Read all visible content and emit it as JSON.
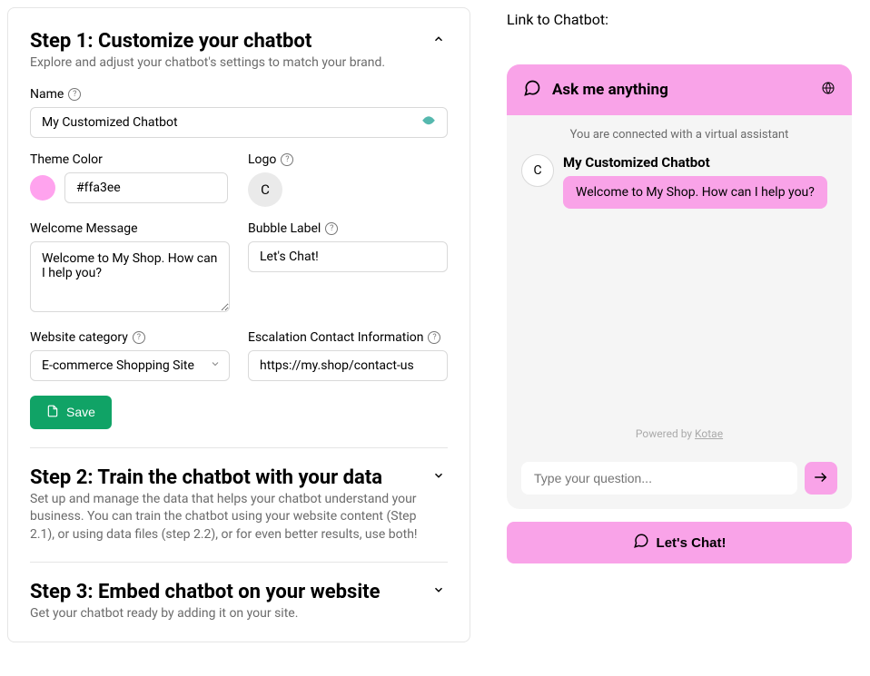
{
  "step1": {
    "title": "Step 1: Customize your chatbot",
    "desc": "Explore and adjust your chatbot's settings to match your brand.",
    "name_label": "Name",
    "name_value": "My Customized Chatbot",
    "theme_color_label": "Theme Color",
    "theme_color_value": "#ffa3ee",
    "logo_label": "Logo",
    "logo_letter": "C",
    "welcome_label": "Welcome Message",
    "welcome_value": "Welcome to My Shop. How can I help you?",
    "bubble_label_label": "Bubble Label",
    "bubble_label_value": "Let's Chat!",
    "category_label": "Website category",
    "category_value": "E-commerce Shopping Site",
    "escalation_label": "Escalation Contact Information",
    "escalation_value": "https://my.shop/contact-us",
    "save_label": "Save"
  },
  "step2": {
    "title": "Step 2: Train the chatbot with your data",
    "desc": "Set up and manage the data that helps your chatbot understand your business. You can train the chatbot using your website content (Step 2.1), or using data files (step 2.2), or for even better results, use both!"
  },
  "step3": {
    "title": "Step 3: Embed chatbot on your website",
    "desc": "Get your chatbot ready by adding it on your site."
  },
  "right": {
    "link_label": "Link to Chatbot:"
  },
  "chat": {
    "header_title": "Ask me anything",
    "connected_text": "You are connected with a virtual assistant",
    "bot_name": "My Customized Chatbot",
    "avatar_letter": "C",
    "welcome_msg": "Welcome to My Shop. How can I help you?",
    "powered_prefix": "Powered by ",
    "powered_name": "Kotae",
    "input_placeholder": "Type your question...",
    "cta_label": "Let's Chat!"
  }
}
